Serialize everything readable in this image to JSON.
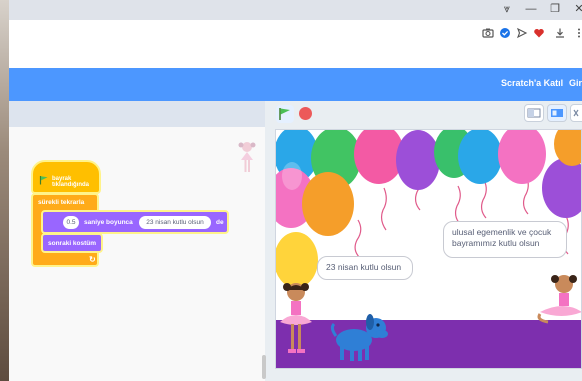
{
  "browser": {
    "window_controls": [
      "⩔",
      "—",
      "❐",
      "✕"
    ],
    "extension_icons": [
      "camera-icon",
      "shield-check-icon",
      "send-icon",
      "heart-icon",
      "download-icon",
      "menu-icon"
    ]
  },
  "menubar": {
    "links": [
      "Scratch'a Katıl",
      "Giri"
    ],
    "color": "#4c97ff"
  },
  "code": {
    "hat_label": "bayrak tıklandığında",
    "forever_label": "sürekli tekrarla",
    "say_value": "0.5",
    "say_middle": "saniye boyunca",
    "say_text": "23 nisan kutlu olsun",
    "say_suffix": "de",
    "looks_label": "sonraki kostüm",
    "loop_arrow": "↻"
  },
  "stage": {
    "bubble_left": "23 nisan kutlu olsun",
    "bubble_right_line1": "ulusal egemenlik ve çocuk",
    "bubble_right_line2": "bayramımız kutlu olsun"
  },
  "colors": {
    "events": "#ffbf00",
    "control": "#ffab19",
    "looks": "#9966ff",
    "stop": "#ec5959",
    "floor": "#7d2fae"
  }
}
